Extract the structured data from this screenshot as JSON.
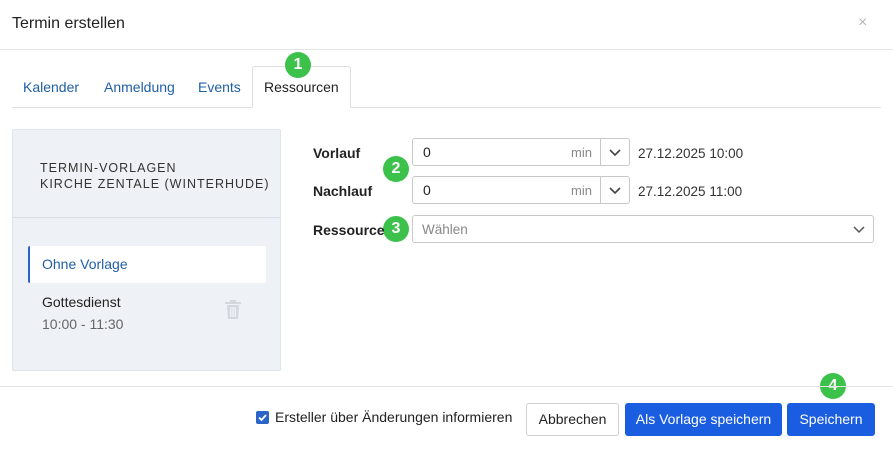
{
  "dialog": {
    "title": "Termin erstellen",
    "close_glyph": "×"
  },
  "tabs": [
    {
      "label": "Kalender",
      "active": false
    },
    {
      "label": "Anmeldung",
      "active": false
    },
    {
      "label": "Events",
      "active": false
    },
    {
      "label": "Ressourcen",
      "active": true
    }
  ],
  "badges": [
    "1",
    "2",
    "3",
    "4"
  ],
  "templates": {
    "title_line1": "TERMIN-VORLAGEN",
    "title_line2": "KIRCHE ZENTALE (WINTERHUDE)",
    "selected": "Ohne Vorlage",
    "items": [
      {
        "name": "Gottesdienst",
        "time": "10:00 - 11:30",
        "icon": "trash-icon"
      }
    ]
  },
  "form": {
    "vorlauf": {
      "label": "Vorlauf",
      "value": "0",
      "unit": "min",
      "date": "27.12.2025 10:00"
    },
    "nachlauf": {
      "label": "Nachlauf",
      "value": "0",
      "unit": "min",
      "date": "27.12.2025 11:00"
    },
    "ressource": {
      "label": "Ressource",
      "placeholder": "Wählen"
    }
  },
  "footer": {
    "notify_label": "Ersteller über Änderungen informieren",
    "notify_checked": true,
    "cancel_label": "Abbrechen",
    "save_template_label": "Als Vorlage speichern",
    "save_label": "Speichern"
  },
  "colors": {
    "primary": "#1a5de0",
    "link": "#1f5fa7",
    "badge": "#3cc14b",
    "panel_bg": "#eef1f6"
  }
}
